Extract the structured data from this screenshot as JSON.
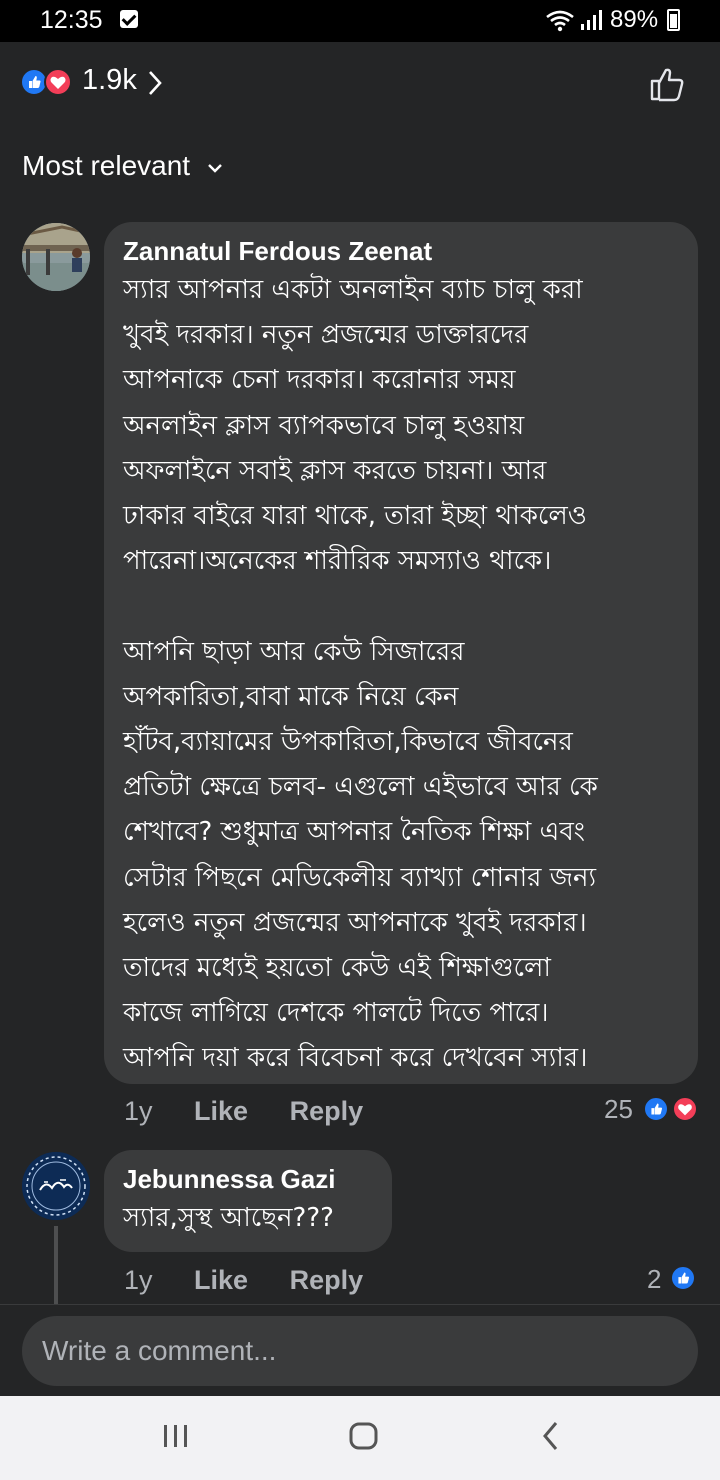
{
  "status_bar": {
    "time": "12:35",
    "battery": "89%",
    "icons": [
      "checkbox-icon",
      "wifi-icon",
      "signal-icon",
      "battery-icon"
    ]
  },
  "reactions": {
    "count": "1.9k",
    "types": [
      "like",
      "love"
    ],
    "colors": {
      "like": "#2078f4",
      "love": "#f33e58"
    }
  },
  "sort": {
    "label": "Most relevant"
  },
  "comments": [
    {
      "author": "Zannatul Ferdous Zeenat",
      "lines": [
        "স্যার আপনার একটা অনলাইন ব্যাচ চালু করা",
        "খুবই দরকার। নতুন প্রজন্মের ডাক্তারদের",
        "আপনাকে চেনা দরকার। করোনার সময়",
        "অনলাইন ক্লাস ব্যাপকভাবে চালু হওয়ায়",
        "অফলাইনে সবাই ক্লাস করতে চায়না। আর",
        "ঢাকার বাইরে যারা থাকে, তারা ইচ্ছা থাকলেও",
        "পারেনা।অনেকের শারীরিক সমস্যাও থাকে।",
        "",
        "আপনি ছাড়া আর কেউ সিজারের",
        "অপকারিতা,বাবা মাকে নিয়ে কেন",
        "হাঁটব,ব্যায়ামের উপকারিতা,কিভাবে জীবনের",
        "প্রতিটা ক্ষেত্রে চলব- এগুলো এইভাবে আর কে",
        "শেখাবে? শুধুমাত্র আপনার নৈতিক শিক্ষা এবং",
        "সেটার পিছনে মেডিকেলীয় ব্যাখ্যা শোনার জন্য",
        "হলেও নতুন প্রজন্মের আপনাকে খুবই দরকার।",
        "তাদের মধ্যেই হয়তো কেউ এই শিক্ষাগুলো",
        "কাজে লাগিয়ে দেশকে পালটে দিতে পারে।",
        "আপনি দয়া করে বিবেচনা করে দেখবেন স্যার।"
      ],
      "time": "1y",
      "like_label": "Like",
      "reply_label": "Reply",
      "reaction_count": "25",
      "reaction_types": [
        "like",
        "love"
      ]
    },
    {
      "author": "Jebunnessa Gazi",
      "lines": [
        "স্যার,সুস্থ আছেন???"
      ],
      "time": "1y",
      "like_label": "Like",
      "reply_label": "Reply",
      "reaction_count": "2",
      "reaction_types": [
        "like"
      ]
    }
  ],
  "composer": {
    "placeholder": "Write a comment..."
  },
  "nav": {
    "buttons": [
      "recent-apps",
      "home",
      "back"
    ]
  }
}
